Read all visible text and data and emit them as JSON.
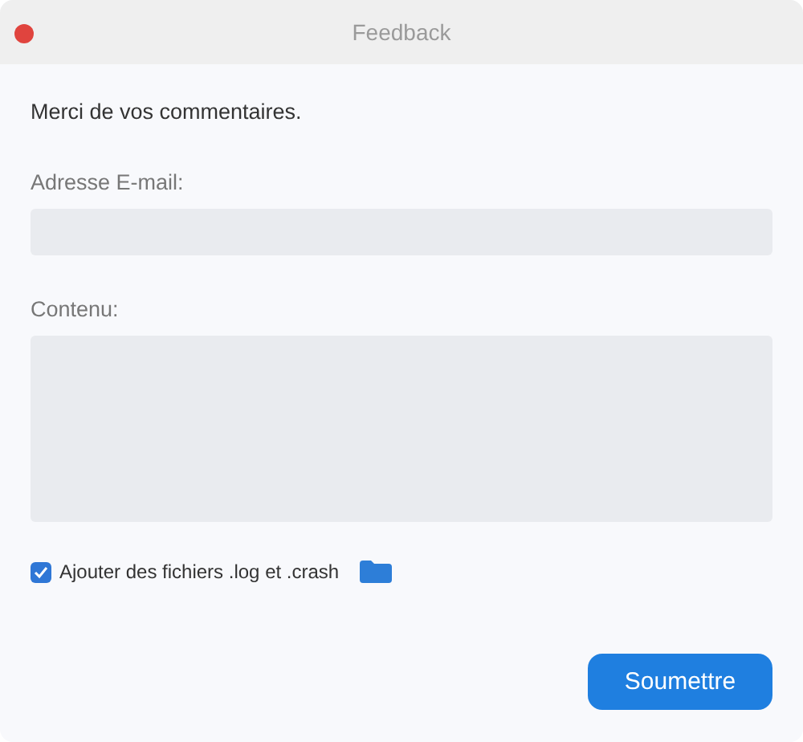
{
  "window": {
    "title": "Feedback"
  },
  "message": "Merci de vos commentaires.",
  "email": {
    "label": "Adresse E-mail:"
  },
  "content": {
    "label": "Contenu:"
  },
  "attach": {
    "label": "Ajouter des fichiers .log et .crash",
    "checked": true
  },
  "submit": "Soumettre"
}
